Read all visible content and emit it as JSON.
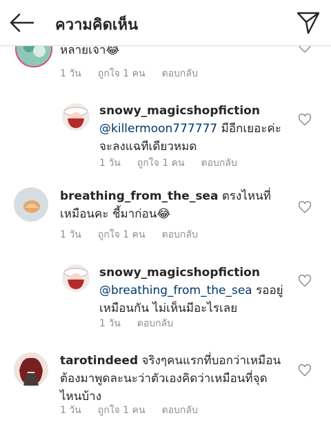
{
  "header": {
    "title": "ความคิดเห็น",
    "back_icon": "arrow-left-icon",
    "send_icon": "send-icon"
  },
  "comments": [
    {
      "text": "หลายเจ้า😂",
      "time": "1 วัน",
      "likes": "ถูกใจ 1 คน",
      "reply": "ตอบกลับ"
    },
    {
      "username": "snowy_magicshopfiction",
      "mention": "@killermoon777777",
      "text1": " มีอีกเยอะค่ะ",
      "text2": "จะลงแฉทีเดียวหมด",
      "time": "1 วัน",
      "likes": "ถูกใจ 1 คน",
      "reply": "ตอบกลับ"
    },
    {
      "username": "breathing_from_the_sea",
      "text1": " ตรงไหนที่",
      "text2": "เหมือนคะ ชี้มาก่อน😂",
      "time": "1 วัน",
      "likes": "ถูกใจ 1 คน",
      "reply": "ตอบกลับ"
    },
    {
      "username": "snowy_magicshopfiction",
      "mention": "@breathing_from_the_sea",
      "text1": " รออยู่",
      "text2": "เหมือนกัน ไม่เห็นมีอะไรเลย",
      "time": "1 วัน",
      "reply": "ตอบกลับ"
    },
    {
      "username": "tarotindeed",
      "text1": " จริงๆคนแรกที่บอกว่าเหมือน",
      "text2": "ต้องมาพูดละนะว่าตัวเองคิดว่าเหมือนที่จุด",
      "text3": "ไหนบ้าง",
      "time": "1 วัน",
      "likes": "ถูกใจ 1 คน",
      "reply": "ตอบกลับ"
    }
  ],
  "colors": {
    "text": "#262626",
    "meta": "#8e8e8e",
    "mention": "#00376b",
    "divider": "#dbdbdb"
  }
}
